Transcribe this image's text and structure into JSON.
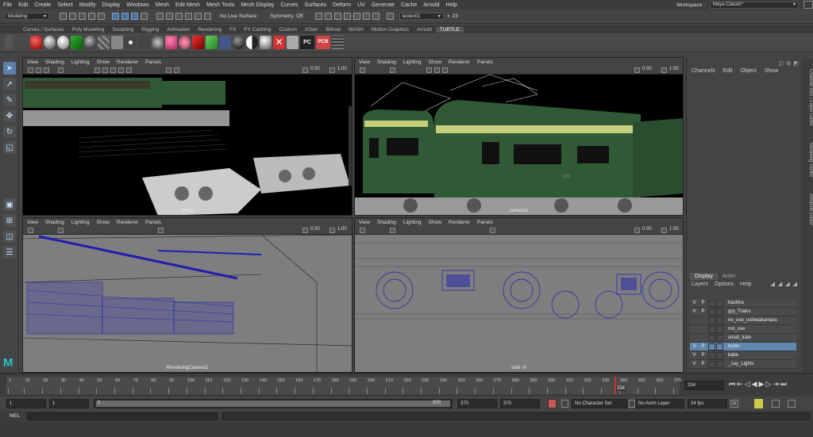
{
  "menubar": {
    "items": [
      "File",
      "Edit",
      "Create",
      "Select",
      "Modify",
      "Display",
      "Windows",
      "Mesh",
      "Edit Mesh",
      "Mesh Tools",
      "Mesh Display",
      "Curves",
      "Surfaces",
      "Deform",
      "UV",
      "Generate",
      "Cache",
      "Arnold",
      "Help"
    ],
    "workspace_label": "Workspace :",
    "workspace_value": "Maya Classic*"
  },
  "status": {
    "mode": "Modeling",
    "live_surface": "No Live Surface",
    "symmetry": "Symmetry: Off",
    "user": "leoleo01",
    "count": "23"
  },
  "shelf": {
    "tabs": [
      "Curves / Surfaces",
      "Poly Modeling",
      "Sculpting",
      "Rigging",
      "Animation",
      "Rendering",
      "FX",
      "FX Caching",
      "Custom",
      "XGen",
      "Bifrost",
      "MASH",
      "Motion Graphics",
      "Arnold",
      "TURTLE"
    ],
    "active": "TURTLE",
    "pc_label": "PC",
    "pcb_label": "PCB"
  },
  "viewport": {
    "menus": [
      "View",
      "Shading",
      "Lighting",
      "Show",
      "Renderer",
      "Panels"
    ],
    "exposure": "0.00",
    "gamma": "1.00"
  },
  "panels": {
    "persp": "persp",
    "camera1": "camera1",
    "render_cam": "RenderingCamera2",
    "side": "side -X",
    "side_text": "EK5"
  },
  "channel": {
    "menus": [
      "Channels",
      "Edit",
      "Object",
      "Show"
    ]
  },
  "vtabs": {
    "t1": "Channel Box / Layer Editor",
    "t2": "Modeling Toolkit",
    "t3": "Attribute Editor"
  },
  "layers": {
    "tabs": [
      "Display",
      "Anim"
    ],
    "menus": [
      "Layers",
      "Options",
      "Help"
    ],
    "rows": [
      {
        "v": "V",
        "p": "P",
        "name": "hashira",
        "selected": false
      },
      {
        "v": "V",
        "p": "P",
        "name": "grp_Trains",
        "selected": false
      },
      {
        "v": "",
        "p": "",
        "name": "no_use_ushiwakamaru",
        "selected": false
      },
      {
        "v": "",
        "p": "",
        "name": "not_use",
        "selected": false
      },
      {
        "v": "",
        "p": "",
        "name": "small_train",
        "selected": false
      },
      {
        "v": "V",
        "p": "P",
        "name": "buhin",
        "selected": true
      },
      {
        "v": "V",
        "p": "P",
        "name": "kabe",
        "selected": false
      },
      {
        "v": "V",
        "p": "P",
        "name": "_1ay_Lights",
        "selected": false
      }
    ]
  },
  "timeline": {
    "ticks": [
      "1",
      "10",
      "20",
      "30",
      "40",
      "50",
      "60",
      "70",
      "80",
      "90",
      "100",
      "110",
      "120",
      "130",
      "140",
      "150",
      "160",
      "170",
      "180",
      "190",
      "200",
      "210",
      "220",
      "230",
      "240",
      "250",
      "260",
      "270",
      "280",
      "290",
      "300",
      "310",
      "320",
      "330",
      "340",
      "350",
      "360",
      "370"
    ],
    "current": "334",
    "current_field": "334"
  },
  "range": {
    "start": "1",
    "anim_start": "1",
    "slider_start": "1",
    "slider_end": "370",
    "anim_end": "370",
    "end": "370",
    "character_set": "No Character Set",
    "anim_layer": "No Anim Layer",
    "fps": "24 fps"
  },
  "cmd": {
    "label": "MEL"
  },
  "colors": {
    "accent": "#5f87b0",
    "wire": "#1f1fb0",
    "train_green": "#2f5a35"
  }
}
